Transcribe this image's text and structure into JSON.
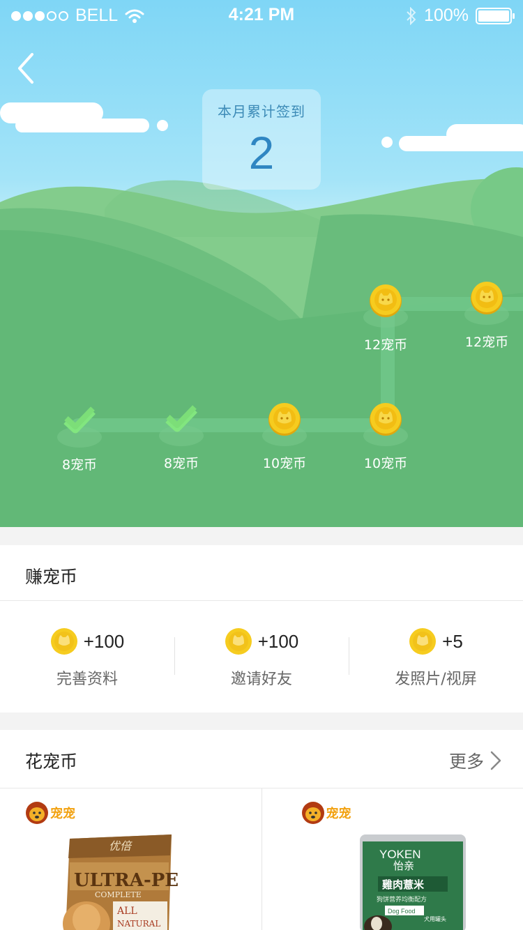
{
  "status_bar": {
    "carrier": "BELL",
    "time": "4:21 PM",
    "battery": "100%",
    "signal_bars_filled": 3,
    "signal_bars_total": 5
  },
  "hero": {
    "sign_card": {
      "label": "本月累计签到",
      "count": "2"
    },
    "days": [
      {
        "reward": "8宠币",
        "checked": true
      },
      {
        "reward": "8宠币",
        "checked": true
      },
      {
        "reward": "10宠币",
        "checked": false
      },
      {
        "reward": "10宠币",
        "checked": false
      },
      {
        "reward": "12宠币",
        "checked": false
      },
      {
        "reward": "12宠币",
        "checked": false
      }
    ]
  },
  "earn": {
    "title": "赚宠币",
    "items": [
      {
        "amount": "+100",
        "label": "完善资料"
      },
      {
        "amount": "+100",
        "label": "邀请好友"
      },
      {
        "amount": "+5",
        "label": "发照片/视屏"
      }
    ]
  },
  "spend": {
    "title": "花宠币",
    "more_label": "更多",
    "products": [
      {
        "brand": "宠宠",
        "package_text": {
          "line1": "优倍",
          "line2": "ULTRA-PET",
          "line3": "COMPLETE",
          "line4": "ALL",
          "line5": "NATURAL"
        }
      },
      {
        "brand": "宠宠",
        "package_text": {
          "line1": "YOKEN",
          "line2": "怡亲",
          "line3": "雞肉薏米",
          "line4": "狗饼营养均衡配方",
          "line5": "Dog Food",
          "line6": "犬用罐头"
        }
      }
    ]
  },
  "colors": {
    "sky_top": "#7fd6f6",
    "grass": "#62b877",
    "coin": "#f6cc1f",
    "check": "#7de07e",
    "card_text": "#2f86c2",
    "brand": "#f2a10f"
  },
  "icons": {
    "back": "chevron-left-icon",
    "wifi": "wifi-icon",
    "bluetooth": "bluetooth-icon",
    "battery": "battery-icon",
    "coin": "pet-coin-icon",
    "check": "checkmark-icon",
    "more": "chevron-right-icon",
    "brand": "dog-logo-icon"
  }
}
